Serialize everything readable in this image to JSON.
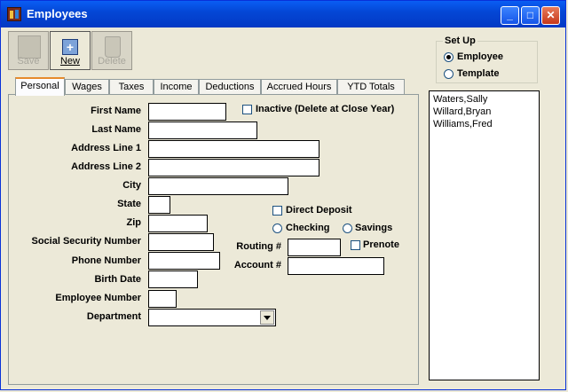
{
  "window": {
    "title": "Employees",
    "min": "_",
    "max": "□",
    "close": "✕"
  },
  "toolbar": {
    "save_label": "Save",
    "new_label": "New",
    "delete_label": "Delete"
  },
  "tabs": [
    "Personal",
    "Wages",
    "Taxes",
    "Income",
    "Deductions",
    "Accrued Hours",
    "YTD Totals"
  ],
  "form": {
    "first_name": "First Name",
    "last_name": "Last Name",
    "address1": "Address Line 1",
    "address2": "Address Line 2",
    "city": "City",
    "state": "State",
    "zip": "Zip",
    "ssn": "Social Security Number",
    "phone": "Phone Number",
    "birth": "Birth Date",
    "emp_num": "Employee Number",
    "department": "Department",
    "inactive": "Inactive (Delete at Close Year)",
    "direct_deposit": "Direct Deposit",
    "checking": "Checking",
    "savings": "Savings",
    "routing": "Routing #",
    "prenote": "Prenote",
    "account": "Account #"
  },
  "setup": {
    "title": "Set Up",
    "employee": "Employee",
    "template": "Template",
    "selected": "Employee"
  },
  "employees": [
    "Waters,Sally",
    "Willard,Bryan",
    "Williams,Fred"
  ]
}
